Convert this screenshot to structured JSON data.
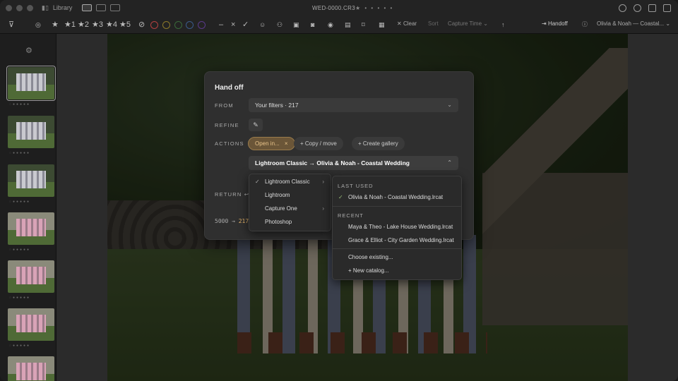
{
  "titlebar": {
    "breadcrumb": "Library",
    "filename": "WED-0000.CR3",
    "rating_dots": "★ • • • • •"
  },
  "toolbar": {
    "star_filters": [
      "★",
      "★1",
      "★2",
      "★3",
      "★4",
      "★5"
    ],
    "clear_label": "Clear",
    "sort_label": "Sort",
    "sort_value": "Capture Time",
    "handoff_label": "Handoff",
    "catalog_label": "Olivia & Noah — Coastal..."
  },
  "panel": {
    "title": "Hand off",
    "from_label": "FROM",
    "from_value": "Your filters · 217",
    "refine_label": "REFINE",
    "actions_label": "ACTIONS",
    "action_open": "Open in...",
    "action_copy": "+ Copy / move",
    "action_gallery": "+ Create gallery",
    "target_value": "Lightroom Classic → Olivia & Noah - Coastal Wedding",
    "return_label": "RETURN ↩",
    "count_from": "5000 →",
    "count_to": "217"
  },
  "app_menu": {
    "items": [
      "Lightroom Classic",
      "Lightroom",
      "Capture One",
      "Photoshop"
    ]
  },
  "catalog_menu": {
    "last_used_label": "LAST USED",
    "last_used": "Olivia & Noah - Coastal Wedding.lrcat",
    "recent_label": "RECENT",
    "recent": [
      "Maya & Theo - Lake House Wedding.lrcat",
      "Grace & Elliot - City Garden Wedding.lrcat"
    ],
    "choose_existing": "Choose existing...",
    "new_catalog": "+ New catalog..."
  }
}
